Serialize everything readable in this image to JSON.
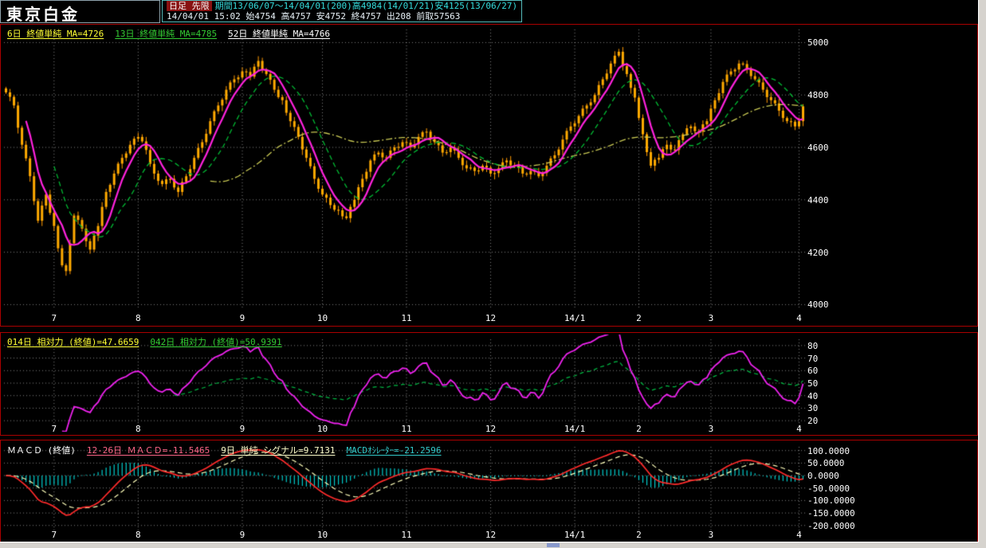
{
  "title": "東京白金",
  "header": {
    "badge": "日足 先限",
    "range_info": "期間13/06/07～14/04/01(200)高4984(14/01/21)安4125(13/06/27)",
    "quote_info": "14/04/01 15:02 始4754 高4757 安4752 終4757 出208 前取57563"
  },
  "colors": {
    "background": "#000000",
    "panel_border": "#aa0000",
    "candle": "#ffaa00",
    "candle_wick": "#ff9900",
    "ma_fast": "#ff22dd",
    "ma_mid": "#00bb33",
    "ma_slow": "#cccc55",
    "rsi_fast": "#ee22ee",
    "rsi_slow": "#00bb44",
    "macd_line": "#ff2b2b",
    "signal_line": "#ffffbb",
    "histogram": "#00cccc",
    "grid": "#ffffff",
    "axis_text": "#ffffff",
    "accent_cyan": "#33dddd",
    "badge_bg": "#881111"
  },
  "chart_data": [
    {
      "type": "candlestick",
      "name": "price-panel",
      "count": 200,
      "legend": [
        {
          "text": "6日 終値単純 MA=4726",
          "color": "#ffff33"
        },
        {
          "text": "13日 終値単純 MA=4785",
          "color": "#33cc33"
        },
        {
          "text": "52日 終値単純 MA=4766",
          "color": "#ffffff"
        }
      ],
      "ma_periods": [
        6,
        13,
        52
      ],
      "period_high": 4984,
      "period_low": 4125,
      "y_ticks": [
        5000,
        4800,
        4600,
        4400,
        4200,
        4000
      ],
      "ylim": [
        3980,
        5050
      ],
      "x_labels": [
        "7",
        "8",
        "9",
        "10",
        "11",
        "12",
        "14/1",
        "2",
        "3",
        "4"
      ],
      "x_label_indices": [
        12,
        33,
        59,
        79,
        100,
        121,
        142,
        158,
        176,
        198
      ],
      "closes": [
        4810,
        4793,
        4760,
        4675,
        4610,
        4558,
        4490,
        4395,
        4320,
        4378,
        4420,
        4350,
        4300,
        4215,
        4150,
        4128,
        4234,
        4340,
        4323,
        4290,
        4242,
        4210,
        4263,
        4300,
        4373,
        4430,
        4457,
        4500,
        4538,
        4560,
        4577,
        4610,
        4633,
        4640,
        4623,
        4590,
        4537,
        4500,
        4472,
        4460,
        4478,
        4480,
        4447,
        4430,
        4468,
        4490,
        4517,
        4560,
        4598,
        4620,
        4652,
        4700,
        4738,
        4760,
        4782,
        4820,
        4848,
        4860,
        4867,
        4890,
        4888,
        4870,
        4908,
        4930,
        4897,
        4880,
        4858,
        4820,
        4792,
        4780,
        4732,
        4700,
        4678,
        4640,
        4592,
        4560,
        4528,
        4480,
        4442,
        4420,
        4408,
        4380,
        4362,
        4360,
        4337,
        4330,
        4373,
        4400,
        4448,
        4480,
        4507,
        4550,
        4573,
        4580,
        4562,
        4560,
        4588,
        4600,
        4602,
        4620,
        4618,
        4600,
        4612,
        4640,
        4658,
        4660,
        4632,
        4620,
        4608,
        4580,
        4582,
        4600,
        4588,
        4560,
        4532,
        4520,
        4523,
        4510,
        4512,
        4530,
        4523,
        4500,
        4502,
        4520,
        4543,
        4550,
        4532,
        4530,
        4523,
        4500,
        4497,
        4510,
        4508,
        4490,
        4502,
        4530,
        4558,
        4570,
        4592,
        4630,
        4663,
        4680,
        4692,
        4720,
        4748,
        4760,
        4772,
        4800,
        4838,
        4860,
        4882,
        4920,
        4950,
        4965,
        4910,
        4880,
        4827,
        4790,
        4712,
        4650,
        4582,
        4530,
        4553,
        4560,
        4593,
        4610,
        4592,
        4590,
        4628,
        4650,
        4673,
        4680,
        4662,
        4660,
        4688,
        4700,
        4748,
        4780,
        4807,
        4850,
        4878,
        4890,
        4897,
        4920,
        4918,
        4900,
        4872,
        4860,
        4848,
        4820,
        4792,
        4780,
        4768,
        4740,
        4712,
        4700,
        4698,
        4680,
        4700,
        4757
      ]
    },
    {
      "type": "line",
      "name": "rsi-panel",
      "legend": [
        {
          "text": "014日 相対力 (終値)=47.6659",
          "color": "#ffff33"
        },
        {
          "text": "042日 相対力 (終値)=50.9391",
          "color": "#33cc33"
        }
      ],
      "periods": [
        14,
        42
      ],
      "y_ticks": [
        80,
        70,
        60,
        50,
        40,
        30,
        20
      ],
      "ylim": [
        15,
        85
      ],
      "x_labels": [
        "7",
        "8",
        "9",
        "10",
        "11",
        "12",
        "14/1",
        "2",
        "3",
        "4"
      ],
      "x_label_indices": [
        12,
        33,
        59,
        79,
        100,
        121,
        142,
        158,
        176,
        198
      ]
    },
    {
      "type": "macd",
      "name": "macd-panel",
      "legend_title": {
        "text": "ＭＡＣＤ (終値)",
        "color": "#ffffff"
      },
      "legend": [
        {
          "text": "12-26日 ＭＡＣＤ=-11.5465",
          "color": "#ff6688"
        },
        {
          "text": "9日 単純 シグナル=9.7131",
          "color": "#ffffcc"
        },
        {
          "text": "MACDｵｼﾚｰﾀｰ=-21.2596",
          "color": "#33cccc"
        }
      ],
      "params": [
        12,
        26,
        9
      ],
      "y_ticks": [
        100,
        50,
        0,
        -50,
        -100,
        -150,
        -200
      ],
      "y_tick_labels": [
        "100.0000",
        "50.0000",
        "0.0000",
        "-50.0000",
        "-100.0000",
        "-150.0000",
        "-200.0000"
      ],
      "ylim": [
        -220,
        115
      ],
      "x_labels": [
        "7",
        "8",
        "9",
        "10",
        "11",
        "12",
        "14/1",
        "2",
        "3",
        "4"
      ],
      "x_label_indices": [
        12,
        33,
        59,
        79,
        100,
        121,
        142,
        158,
        176,
        198
      ]
    }
  ]
}
